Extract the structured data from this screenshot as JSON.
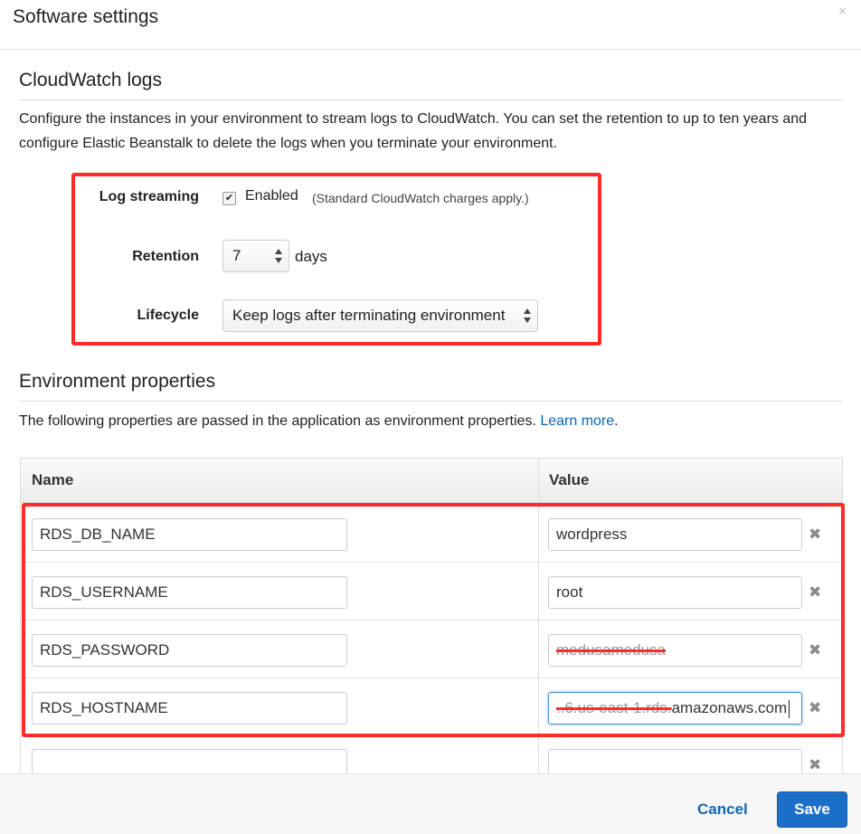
{
  "dialog": {
    "title": "Software settings",
    "close_glyph": "×"
  },
  "cloudwatch": {
    "heading": "CloudWatch logs",
    "description": "Configure the instances in your environment to stream logs to CloudWatch. You can set the retention to up to ten years and configure Elastic Beanstalk to delete the logs when you terminate your environment.",
    "log_streaming": {
      "label": "Log streaming",
      "checked": true,
      "check_glyph": "✔",
      "option_label": "Enabled",
      "note": "(Standard CloudWatch charges apply.)"
    },
    "retention": {
      "label": "Retention",
      "value": "7",
      "unit": "days"
    },
    "lifecycle": {
      "label": "Lifecycle",
      "value": "Keep logs after terminating environment"
    }
  },
  "env": {
    "heading": "Environment properties",
    "description": "The following properties are passed in the application as environment properties.",
    "learn_more": "Learn more",
    "trailing_period": ".",
    "columns": {
      "name": "Name",
      "value": "Value"
    },
    "rows": [
      {
        "name": "RDS_DB_NAME",
        "value": "wordpress"
      },
      {
        "name": "RDS_USERNAME",
        "value": "root"
      },
      {
        "name": "RDS_PASSWORD",
        "value": "medusamedusa",
        "redacted": true
      },
      {
        "name": "RDS_HOSTNAME",
        "value_redacted": "..6.us-east-1.rds.",
        "value": "amazonaws.com",
        "focused": true
      },
      {
        "name": "",
        "value": ""
      }
    ],
    "delete_glyph": "✖"
  },
  "footer": {
    "cancel_label": "Cancel",
    "save_label": "Save"
  },
  "colors": {
    "accent": "#1c6fc9",
    "annotation_red": "#ff2a2a",
    "link": "#0066bb"
  }
}
